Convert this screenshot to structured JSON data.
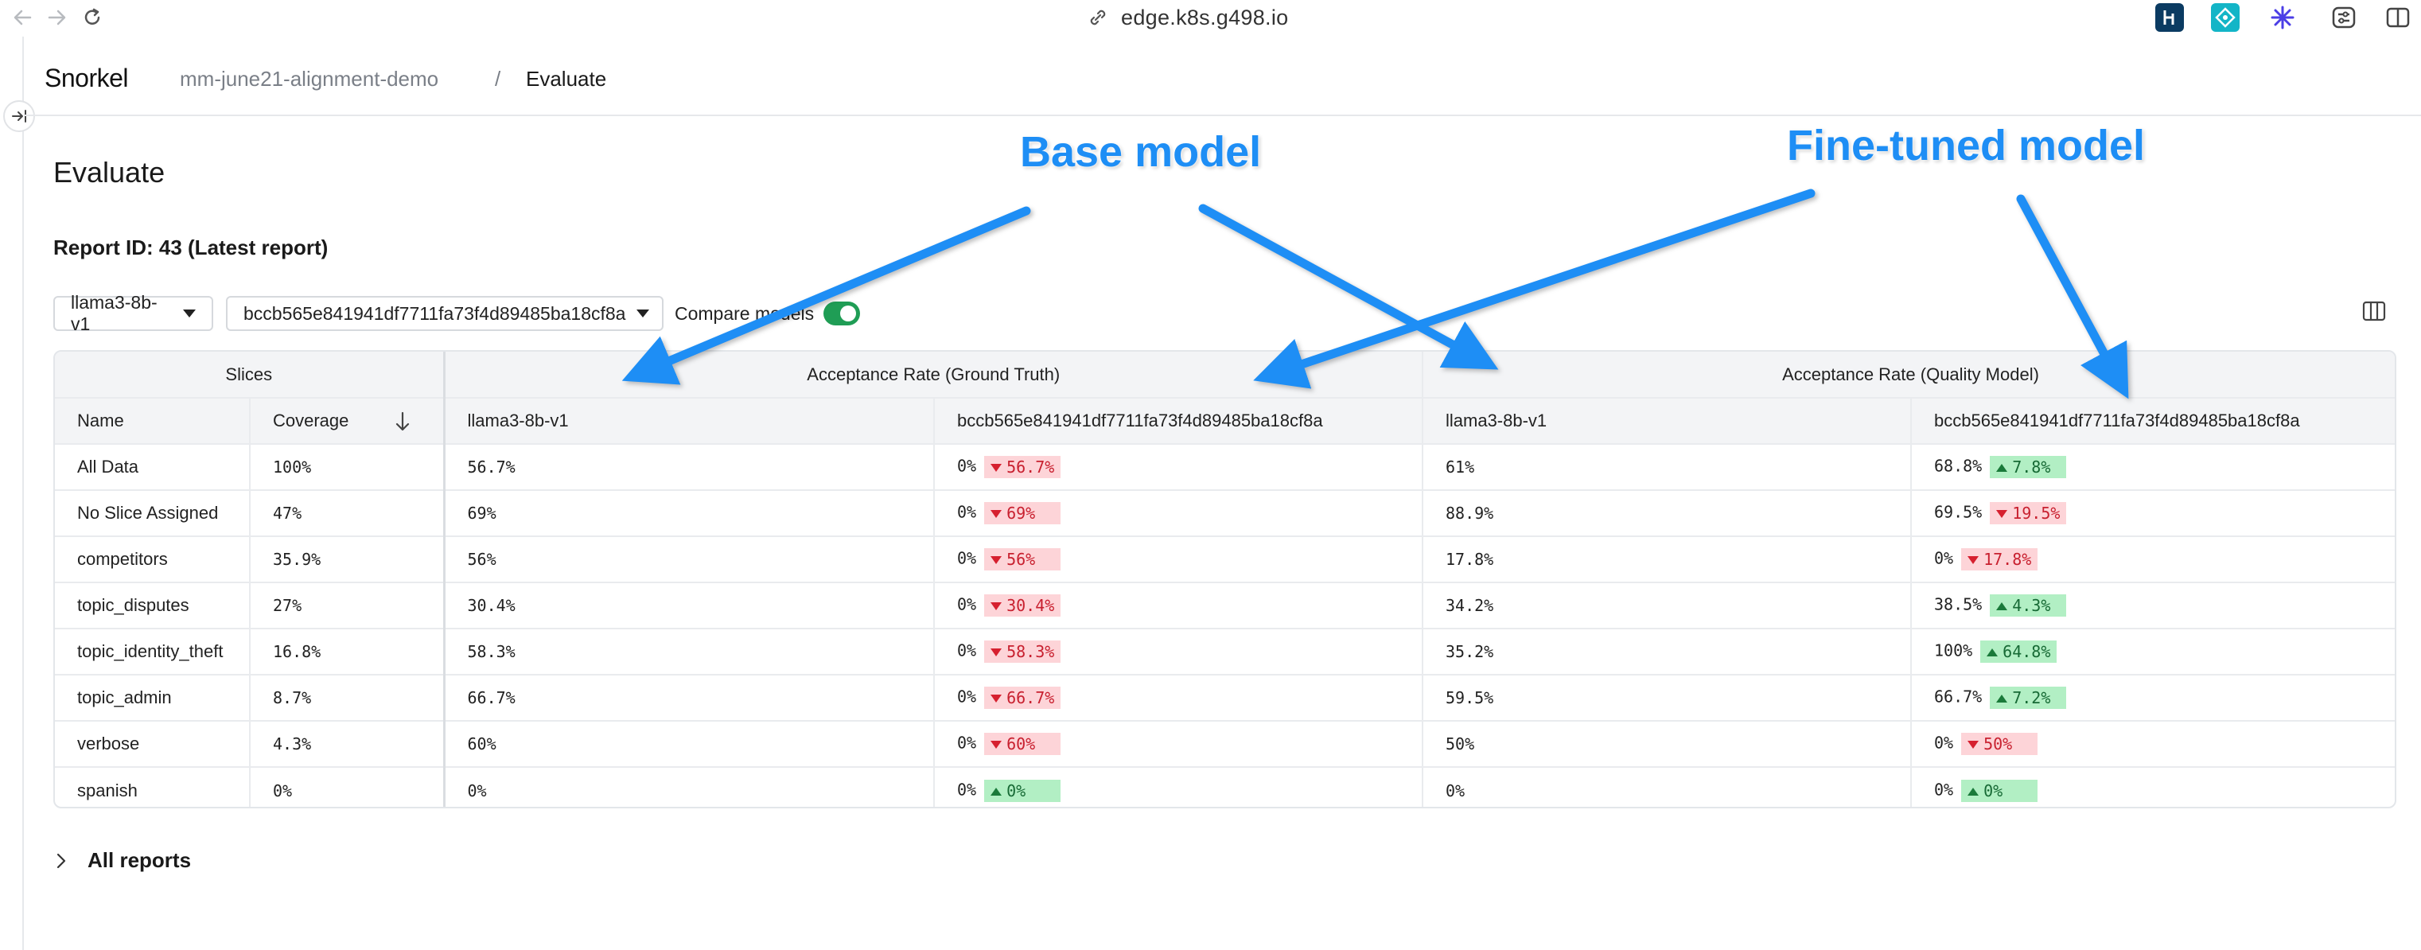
{
  "browser": {
    "url": "edge.k8s.g498.io"
  },
  "app": {
    "logo": "Snorkel",
    "breadcrumb": {
      "project": "mm-june21-alignment-demo",
      "separator": "/",
      "current": "Evaluate"
    }
  },
  "page": {
    "title": "Evaluate",
    "report_id": "Report ID: 43 (Latest report)"
  },
  "controls": {
    "model_a": "llama3-8b-v1",
    "model_b": "bccb565e841941df7711fa73f4d89485ba18cf8a",
    "compare_label": "Compare models",
    "compare_enabled": true
  },
  "table": {
    "group_headers": [
      "Slices",
      "Acceptance Rate (Ground Truth)",
      "Acceptance Rate (Quality Model)"
    ],
    "columns": [
      "Name",
      "Coverage",
      "llama3-8b-v1",
      "bccb565e841941df7711fa73f4d89485ba18cf8a",
      "llama3-8b-v1",
      "bccb565e841941df7711fa73f4d89485ba18cf8a"
    ],
    "rows": [
      {
        "name": "All Data",
        "coverage": "100%",
        "gt_a": "56.7%",
        "gt_b": "0%",
        "gt_delta": "56.7%",
        "gt_dir": "down",
        "qm_a": "61%",
        "qm_b": "68.8%",
        "qm_delta": "7.8%",
        "qm_dir": "up"
      },
      {
        "name": "No Slice Assigned",
        "coverage": "47%",
        "gt_a": "69%",
        "gt_b": "0%",
        "gt_delta": "69%",
        "gt_dir": "down",
        "qm_a": "88.9%",
        "qm_b": "69.5%",
        "qm_delta": "19.5%",
        "qm_dir": "down"
      },
      {
        "name": "competitors",
        "coverage": "35.9%",
        "gt_a": "56%",
        "gt_b": "0%",
        "gt_delta": "56%",
        "gt_dir": "down",
        "qm_a": "17.8%",
        "qm_b": "0%",
        "qm_delta": "17.8%",
        "qm_dir": "down"
      },
      {
        "name": "topic_disputes",
        "coverage": "27%",
        "gt_a": "30.4%",
        "gt_b": "0%",
        "gt_delta": "30.4%",
        "gt_dir": "down",
        "qm_a": "34.2%",
        "qm_b": "38.5%",
        "qm_delta": "4.3%",
        "qm_dir": "up"
      },
      {
        "name": "topic_identity_theft",
        "coverage": "16.8%",
        "gt_a": "58.3%",
        "gt_b": "0%",
        "gt_delta": "58.3%",
        "gt_dir": "down",
        "qm_a": "35.2%",
        "qm_b": "100%",
        "qm_delta": "64.8%",
        "qm_dir": "up"
      },
      {
        "name": "topic_admin",
        "coverage": "8.7%",
        "gt_a": "66.7%",
        "gt_b": "0%",
        "gt_delta": "66.7%",
        "gt_dir": "down",
        "qm_a": "59.5%",
        "qm_b": "66.7%",
        "qm_delta": "7.2%",
        "qm_dir": "up"
      },
      {
        "name": "verbose",
        "coverage": "4.3%",
        "gt_a": "60%",
        "gt_b": "0%",
        "gt_delta": "60%",
        "gt_dir": "down",
        "qm_a": "50%",
        "qm_b": "0%",
        "qm_delta": "50%",
        "qm_dir": "down"
      },
      {
        "name": "spanish",
        "coverage": "0%",
        "gt_a": "0%",
        "gt_b": "0%",
        "gt_delta": "0%",
        "gt_dir": "up",
        "qm_a": "0%",
        "qm_b": "0%",
        "qm_delta": "0%",
        "qm_dir": "up"
      }
    ]
  },
  "all_reports_label": "All reports",
  "annotations": {
    "base_model": "Base model",
    "fine_tuned_model": "Fine-tuned model",
    "color": "#1e8ef5"
  },
  "colors": {
    "toggle_on": "#1f9d55",
    "delta_down_bg": "#fdd4d8",
    "delta_up_bg": "#b2efc4"
  }
}
